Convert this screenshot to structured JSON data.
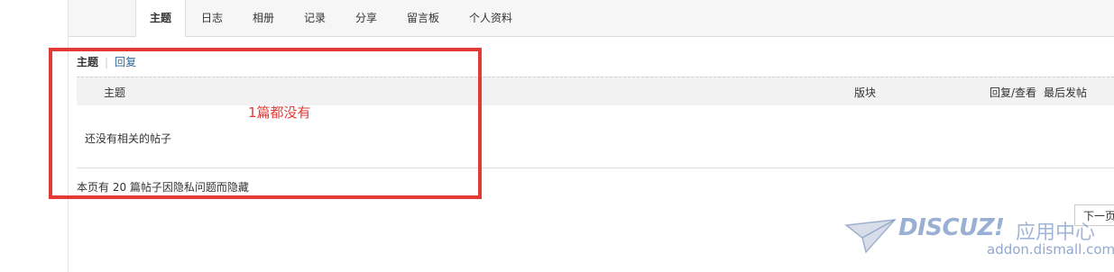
{
  "tabs": {
    "items": [
      {
        "label": "主题",
        "active": true
      },
      {
        "label": "日志"
      },
      {
        "label": "相册"
      },
      {
        "label": "记录"
      },
      {
        "label": "分享"
      },
      {
        "label": "留言板"
      },
      {
        "label": "个人资料"
      }
    ]
  },
  "subnav": {
    "active_label": "主题",
    "separator": "|",
    "reply_label": "回复"
  },
  "table": {
    "columns": {
      "subject": "主题",
      "forum": "版块",
      "reply_view": "回复/查看",
      "last_post": "最后发帖"
    },
    "empty_message": "还没有相关的帖子"
  },
  "annotation": {
    "text": "1篇都没有",
    "color": "#e53935"
  },
  "hidden_note": "本页有 20 篇帖子因隐私问题而隐藏",
  "pagination": {
    "next_label": "下一页"
  },
  "watermark": {
    "logo_text": "DISCUZ!",
    "app_text": "应用中心",
    "url_text": "addon.dismall.com"
  },
  "colors": {
    "link": "#336699",
    "accent_red": "#e53935",
    "tabbar_bg": "#f6f6f6"
  }
}
